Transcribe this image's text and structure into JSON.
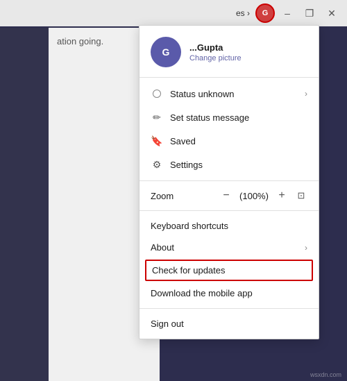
{
  "titlebar": {
    "lang": "es",
    "lang_chevron": "›",
    "avatar_label": "G",
    "minimize_label": "–",
    "restore_label": "❐",
    "close_label": "✕"
  },
  "app": {
    "content_text": "ation going."
  },
  "profile": {
    "initials": "G",
    "name": "...Gupta",
    "change_picture": "Change picture"
  },
  "menu": {
    "status_unknown": "Status unknown",
    "set_status": "Set status message",
    "saved": "Saved",
    "settings": "Settings"
  },
  "zoom": {
    "label": "Zoom",
    "minus": "−",
    "value": "(100%)",
    "plus": "+",
    "fullscreen": "⊡"
  },
  "bottom_menu": {
    "keyboard_shortcuts": "Keyboard shortcuts",
    "about": "About",
    "check_updates": "Check for updates",
    "download_app": "Download the mobile app",
    "sign_out": "Sign out"
  },
  "watermark": "wsxdn.com"
}
